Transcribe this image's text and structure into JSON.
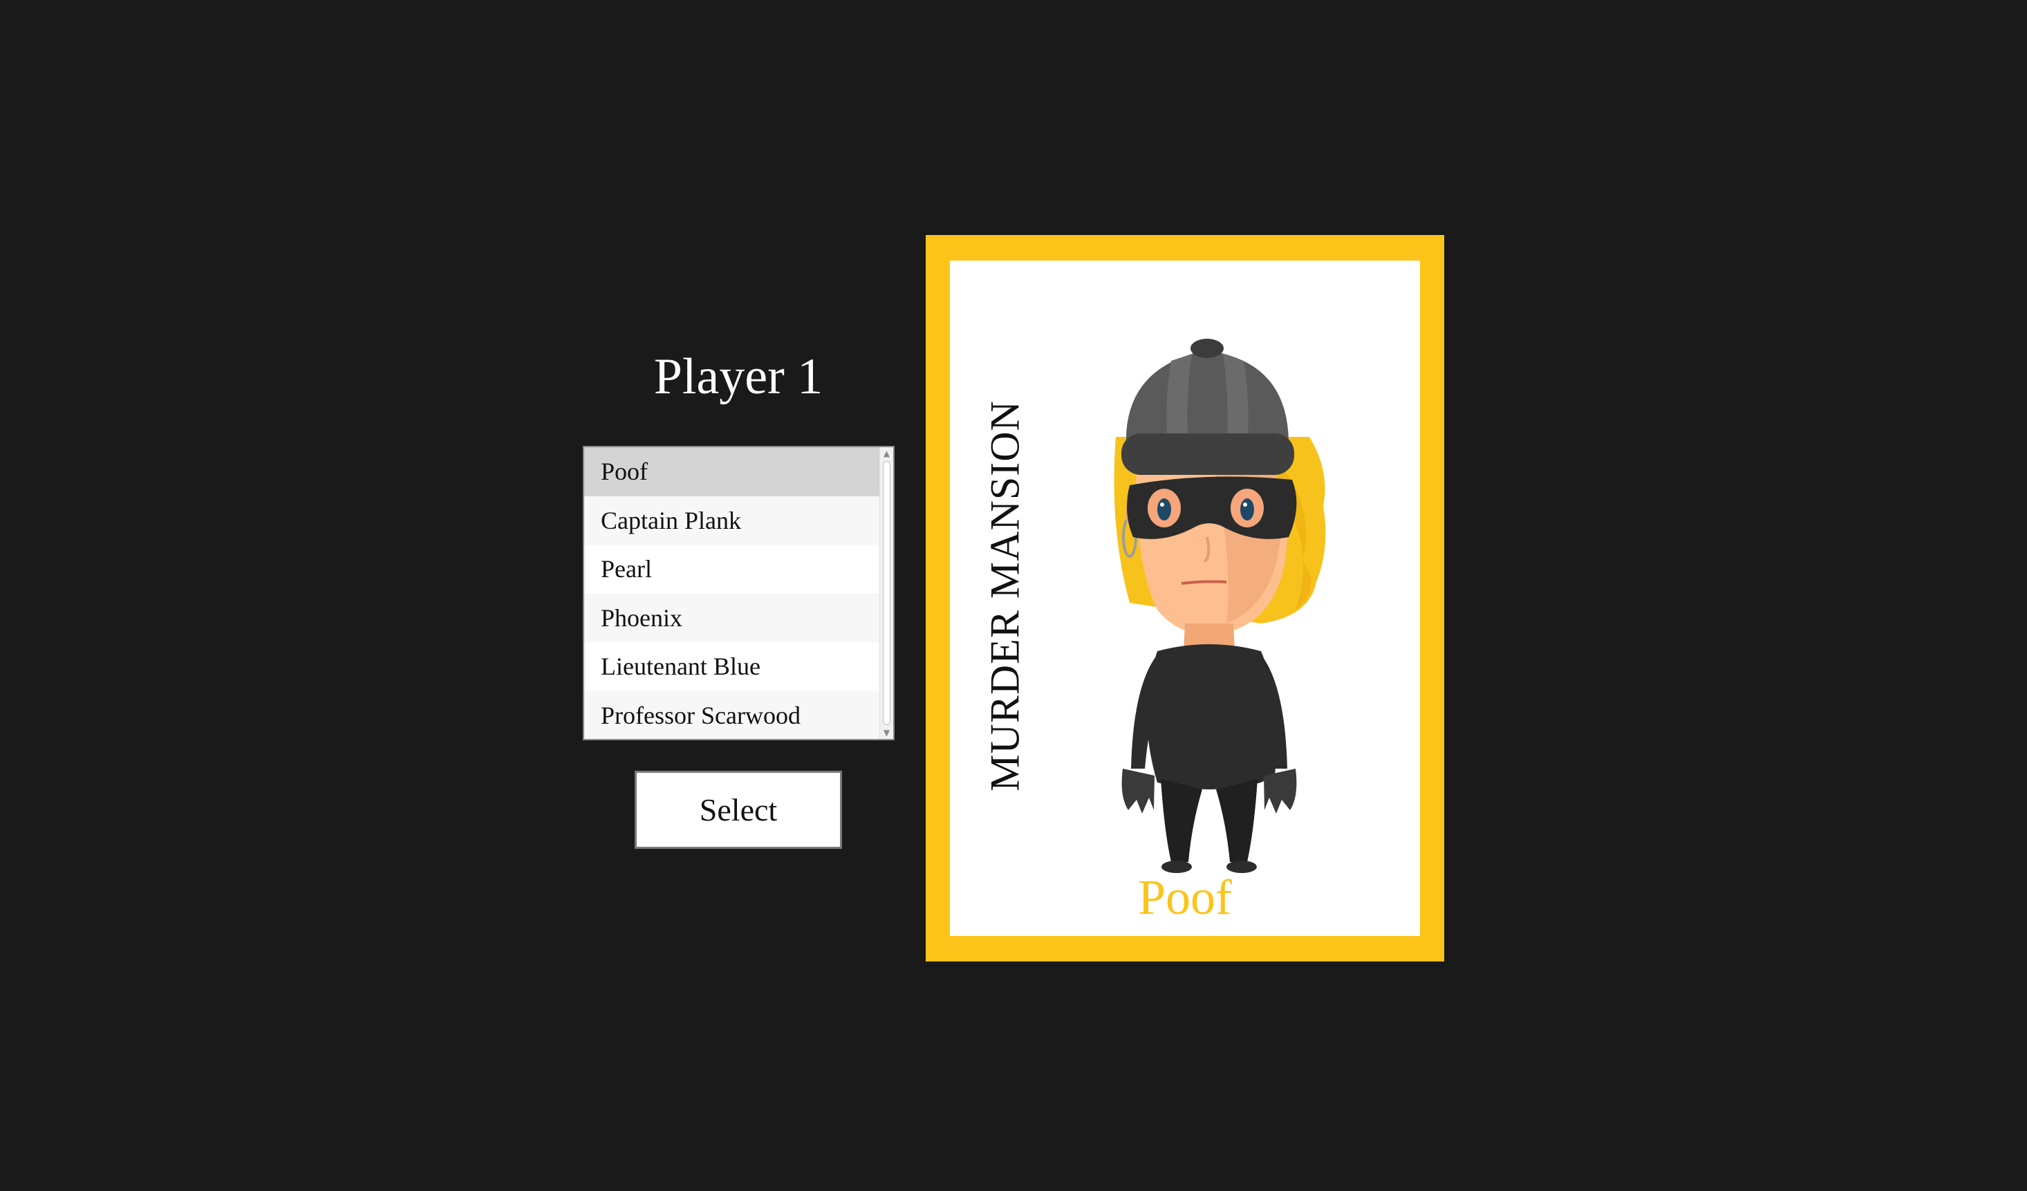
{
  "player": {
    "title": "Player 1"
  },
  "characters": {
    "items": [
      {
        "label": "Poof"
      },
      {
        "label": "Captain Plank"
      },
      {
        "label": "Pearl"
      },
      {
        "label": "Phoenix"
      },
      {
        "label": "Lieutenant Blue"
      },
      {
        "label": "Professor Scarwood"
      }
    ],
    "selected": "Poof"
  },
  "actions": {
    "select_label": "Select"
  },
  "card": {
    "game_title": "MURDER MANSION",
    "character_name": "Poof",
    "portrait_icon": "masked-burglar-icon",
    "border_color": "#fcc419",
    "accent_color": "#fcc419"
  },
  "theme": {
    "background": "#1a1a1a"
  }
}
